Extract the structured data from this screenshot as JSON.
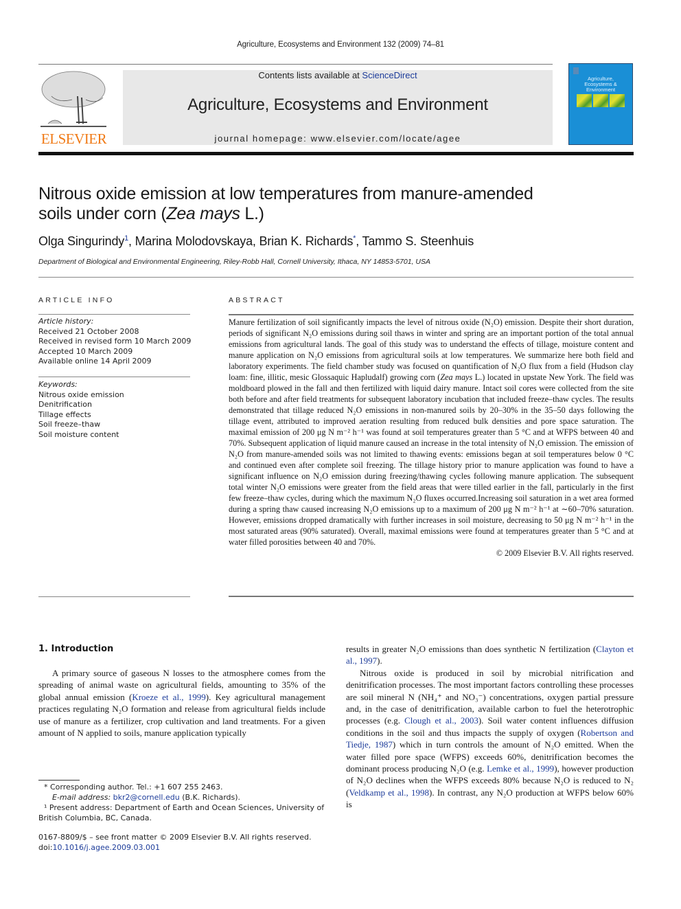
{
  "running_head": "Agriculture, Ecosystems and Environment 132 (2009) 74–81",
  "banner": {
    "contents_prefix": "Contents lists available at ",
    "contents_link": "ScienceDirect",
    "journal_title": "Agriculture, Ecosystems and Environment",
    "homepage": "journal homepage: www.elsevier.com/locate/agee"
  },
  "publisher_logo": {
    "wordmark": "ELSEVIER",
    "color": "#f07a16"
  },
  "cover": {
    "title_lines": [
      "Agriculture,",
      "Ecosystems &",
      "Environment"
    ],
    "color": "#1a8fd6"
  },
  "article": {
    "title_line1": "Nitrous oxide emission at low temperatures from manure-amended",
    "title_line2_prefix": "soils under corn (",
    "title_italic": "Zea mays",
    "title_line2_suffix": " L.)",
    "authors": [
      {
        "name": "Olga Singurindy",
        "mark": "1"
      },
      {
        "name": "Marina Molodovskaya",
        "mark": ""
      },
      {
        "name": "Brian K. Richards",
        "mark": "*"
      },
      {
        "name": "Tammo S. Steenhuis",
        "mark": ""
      }
    ],
    "affiliation": "Department of Biological and Environmental Engineering, Riley-Robb Hall, Cornell University, Ithaca, NY 14853-5701, USA"
  },
  "article_info": {
    "heading": "ARTICLE INFO",
    "history_label": "Article history:",
    "history": [
      "Received 21 October 2008",
      "Received in revised form 10 March 2009",
      "Accepted 10 March 2009",
      "Available online 14 April 2009"
    ],
    "keywords_label": "Keywords:",
    "keywords": [
      "Nitrous oxide emission",
      "Denitrification",
      "Tillage effects",
      "Soil freeze–thaw",
      "Soil moisture content"
    ]
  },
  "abstract": {
    "heading": "ABSTRACT",
    "segments": [
      "Manure fertilization of soil significantly impacts the level of nitrous oxide (N₂O) emission. Despite their short duration, periods of significant N₂O emissions during soil thaws in winter and spring are an important portion of the total annual emissions from agricultural lands. The goal of this study was to understand the effects of tillage, moisture content and manure application on N₂O emissions from agricultural soils at low temperatures. We summarize here both field and laboratory experiments. The field chamber study was focused on quantification of N₂O flux from a field (Hudson clay loam: fine, illitic, mesic Glossaquic Hapludalf) growing corn (",
      "Zea mays",
      " L.) located in upstate New York. The field was moldboard plowed in the fall and then fertilized with liquid dairy manure. Intact soil cores were collected from the site both before and after field treatments for subsequent laboratory incubation that included freeze–thaw cycles. The results demonstrated that tillage reduced N₂O emissions in non-manured soils by 20–30% in the 35–50 days following the tillage event, attributed to improved aeration resulting from reduced bulk densities and pore space saturation. The maximal emission of 200 μg N m⁻² h⁻¹ was found at soil temperatures greater than 5 °C and at WFPS between 40 and 70%. Subsequent application of liquid manure caused an increase in the total intensity of N₂O emission. The emission of N₂O from manure-amended soils was not limited to thawing events: emissions began at soil temperatures below 0 °C and continued even after complete soil freezing. The tillage history prior to manure application was found to have a significant influence on N₂O emission during freezing/thawing cycles following manure application. The subsequent total winter N₂O emissions were greater from the field areas that were tilled earlier in the fall, particularly in the first few freeze–thaw cycles, during which the maximum N₂O fluxes occurred.Increasing soil saturation in a wet area formed during a spring thaw caused increasing N₂O emissions up to a maximum of 200 μg N m⁻² h⁻¹ at ∼60–70% saturation. However, emissions dropped dramatically with further increases in soil moisture, decreasing to 50 μg N m⁻² h⁻¹ in the most saturated areas (90% saturated). Overall, maximal emissions were found at temperatures greater than 5 °C and at water filled porosities between 40 and 70%."
    ],
    "copyright": "© 2009 Elsevier B.V. All rights reserved."
  },
  "introduction": {
    "heading": "1.  Introduction",
    "col1": {
      "p1_a": "A primary source of gaseous N losses to the atmosphere comes from the spreading of animal waste on agricultural fields, amounting to 35% of the global annual emission (",
      "p1_link1": "Kroeze et al., 1999",
      "p1_b": "). Key agricultural management practices regulating N₂O formation and release from agricultural fields include use of manure as a fertilizer, crop cultivation and land treatments. For a given amount of N applied to soils, manure application typically"
    },
    "col2": {
      "p1_a": "results in greater N₂O emissions than does synthetic N fertilization (",
      "p1_link1": "Clayton et al., 1997",
      "p1_b": ").",
      "p2_a": "Nitrous oxide is produced in soil by microbial nitrification and denitrification processes. The most important factors controlling these processes are soil mineral N (NH₄⁺ and NO₃⁻) concentrations, oxygen partial pressure and, in the case of denitrification, available carbon to fuel the heterotrophic processes (e.g. ",
      "p2_link1": "Clough et al., 2003",
      "p2_b": "). Soil water content influences diffusion conditions in the soil and thus impacts the supply of oxygen (",
      "p2_link2": "Robertson and Tiedje, 1987",
      "p2_c": ") which in turn controls the amount of N₂O emitted. When the water filled pore space (WFPS) exceeds 60%, denitrification becomes the dominant process producing N₂O (e.g. ",
      "p2_link3": "Lemke et al., 1999",
      "p2_d": "), however production of N₂O declines when the WFPS exceeds 80% because N₂O is reduced to N₂ (",
      "p2_link4": "Veldkamp et al., 1998",
      "p2_e": "). In contrast, any N₂O production at WFPS below 60% is"
    }
  },
  "footnotes": {
    "corresponding": "* Corresponding author. Tel.: +1 607 255 2463.",
    "email_label": "E-mail address: ",
    "email": "bkr2@cornell.edu",
    "email_suffix": " (B.K. Richards).",
    "present_address": "¹ Present address: Department of Earth and Ocean Sciences, University of British Columbia, BC, Canada.",
    "front_matter": "0167-8809/$ – see front matter © 2009 Elsevier B.V. All rights reserved.",
    "doi_label": "doi:",
    "doi": "10.1016/j.agee.2009.03.001"
  }
}
